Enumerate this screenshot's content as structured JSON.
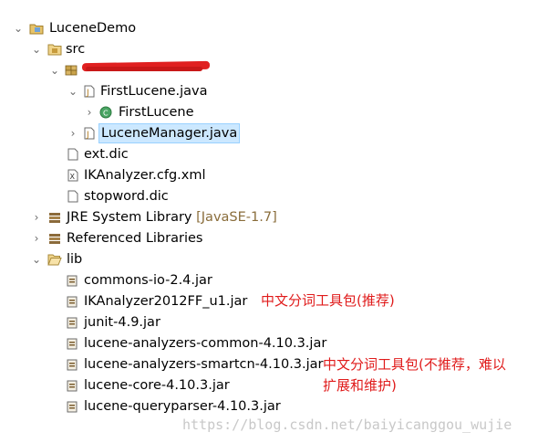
{
  "tree": {
    "project": "LuceneDemo",
    "src": "src",
    "package": "",
    "file_firstlucene": "FirstLucene.java",
    "class_firstlucene": "FirstLucene",
    "file_lucenemanager": "LuceneManager.java",
    "file_extdic": "ext.dic",
    "file_ikcfg": "IKAnalyzer.cfg.xml",
    "file_stopword": "stopword.dic",
    "jre_label": "JRE System Library",
    "jre_decoration": "[JavaSE-1.7]",
    "referenced_libraries": "Referenced Libraries",
    "lib": "lib",
    "jars": [
      "commons-io-2.4.jar",
      "IKAnalyzer2012FF_u1.jar",
      "junit-4.9.jar",
      "lucene-analyzers-common-4.10.3.jar",
      "lucene-analyzers-smartcn-4.10.3.jar",
      "lucene-core-4.10.3.jar",
      "lucene-queryparser-4.10.3.jar"
    ]
  },
  "annotations": {
    "ik_note": "中文分词工具包(推荐)",
    "smartcn_note_line1": "中文分词工具包(不推荐，难以",
    "smartcn_note_line2": "扩展和维护)"
  },
  "watermark": "https://blog.csdn.net/baiyicanggou_wujie",
  "colors": {
    "selection_bg": "#cce8ff",
    "annotation_red": "#e01b1b",
    "decoration_brown": "#8a6d3b"
  }
}
